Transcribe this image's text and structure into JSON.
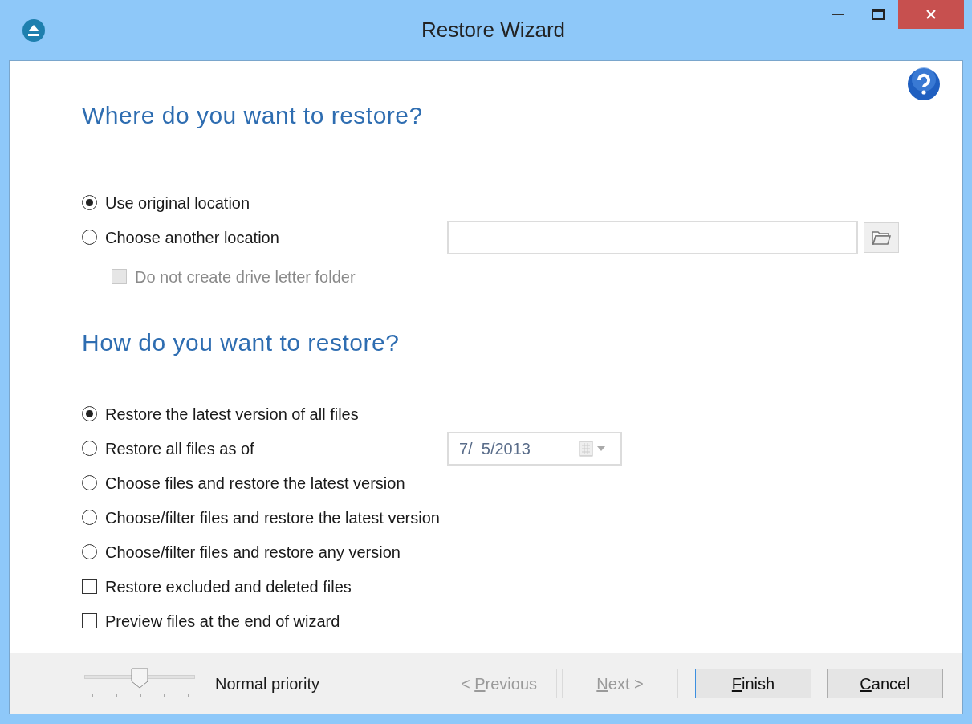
{
  "window": {
    "title": "Restore Wizard"
  },
  "where": {
    "heading": "Where do you want to restore?",
    "options": [
      {
        "kind": "radio",
        "label": "Use original location",
        "selected": true
      },
      {
        "kind": "radio_path",
        "label": "Choose another location",
        "selected": false
      }
    ],
    "sub_option": {
      "label": "Do not create drive letter folder",
      "checked": false,
      "disabled": true
    }
  },
  "how": {
    "heading": "How do you want to restore?",
    "options": [
      {
        "kind": "radio",
        "label": "Restore the latest version of all files",
        "selected": true
      },
      {
        "kind": "radio_date",
        "label": "Restore all files as of",
        "selected": false,
        "date": "7/  5/2013"
      },
      {
        "kind": "radio",
        "label": "Choose files and restore the latest version",
        "selected": false
      },
      {
        "kind": "radio",
        "label": "Choose/filter files and restore the latest version",
        "selected": false
      },
      {
        "kind": "radio",
        "label": "Choose/filter files and restore any version",
        "selected": false
      },
      {
        "kind": "checkbox",
        "label": "Restore excluded and deleted files",
        "checked": false
      },
      {
        "kind": "checkbox",
        "label": "Preview files at the end of wizard",
        "checked": false
      }
    ]
  },
  "priority": {
    "label": "Normal priority",
    "level": 0.5
  },
  "buttons": [
    {
      "label": {
        "before": "< ",
        "access_key": "P",
        "after": "revious"
      },
      "disabled": true,
      "default": false
    },
    {
      "label": {
        "access_key": "N",
        "after": "ext >"
      },
      "disabled": true,
      "default": false
    },
    {
      "label": {
        "access_key": "F",
        "after": "inish"
      },
      "disabled": false,
      "default": true
    },
    {
      "label": {
        "access_key": "C",
        "after": "ancel"
      },
      "disabled": false,
      "default": false
    }
  ]
}
